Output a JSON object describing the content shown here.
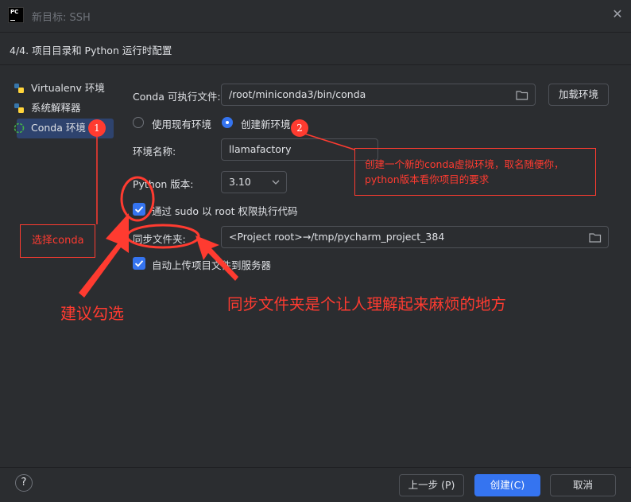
{
  "window": {
    "title": "新目标: SSH"
  },
  "step": {
    "label": "4/4. 项目目录和 Python 运行时配置"
  },
  "sidebar": {
    "items": [
      {
        "label": "Virtualenv 环境"
      },
      {
        "label": "系统解释器"
      },
      {
        "label": "Conda 环境"
      }
    ]
  },
  "form": {
    "conda_label": "Conda 可执行文件:",
    "conda_path": "/root/miniconda3/bin/conda",
    "load_env_label": "加载环境",
    "use_existing_label": "使用现有环境",
    "create_new_label": "创建新环境",
    "env_name_label": "环境名称:",
    "env_name_value": "llamafactory",
    "python_version_label": "Python 版本:",
    "python_version_value": "3.10",
    "sudo_label": "通过 sudo 以 root 权限执行代码",
    "sync_label": "同步文件夹:",
    "sync_value": "<Project root>→/tmp/pycharm_project_384",
    "auto_upload_label": "自动上传项目文件到服务器"
  },
  "footer": {
    "help": "?",
    "prev_label": "上一步 (P)",
    "create_label": "创建(C)",
    "cancel_label": "取消"
  },
  "annotations": {
    "badge1": "1",
    "badge2": "2",
    "select_conda": "选择conda",
    "recommend_check": "建议勾选",
    "note_new_env": "创建一个新的conda虚拟环境，取名随便你，python版本看你项目的要求",
    "sync_confusing": "同步文件夹是个让人理解起来麻烦的地方"
  },
  "colors": {
    "accent": "#3574f0",
    "annotation": "#ff3b30",
    "background": "#2b2d30"
  }
}
